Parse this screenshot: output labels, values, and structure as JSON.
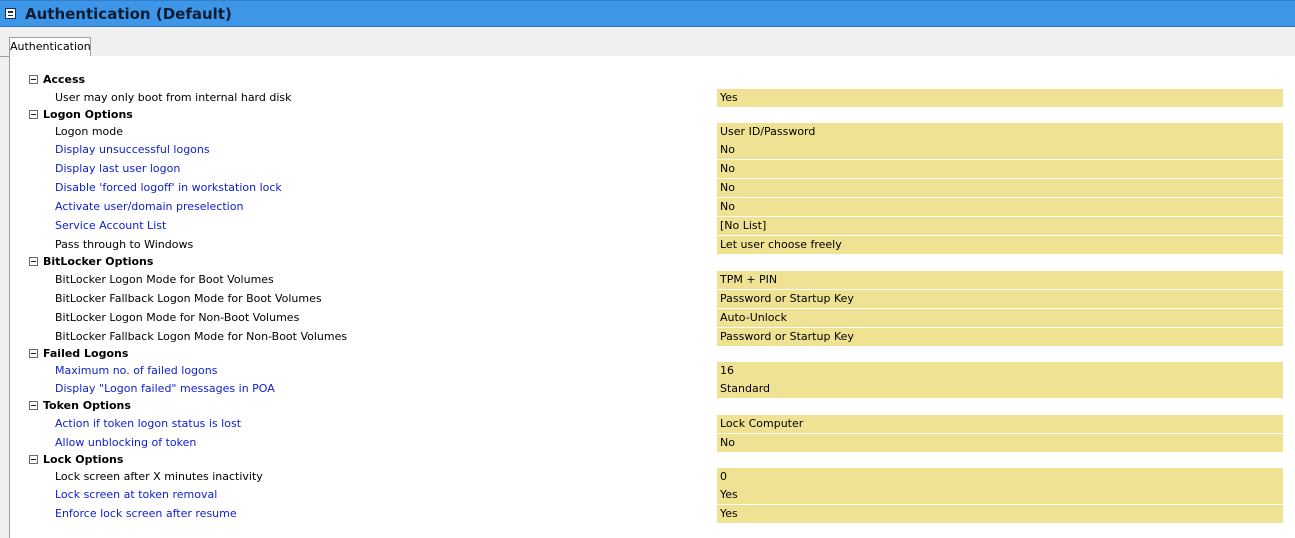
{
  "window": {
    "title": "Authentication (Default)"
  },
  "tabs": [
    {
      "label": "Authentication"
    }
  ],
  "sections": [
    {
      "title": "Access",
      "items": [
        {
          "label": "User may only boot from internal hard disk",
          "value": "Yes",
          "link": false
        }
      ]
    },
    {
      "title": "Logon Options",
      "items": [
        {
          "label": "Logon mode",
          "value": "User ID/Password",
          "link": false
        },
        {
          "label": "Display unsuccessful logons",
          "value": "No",
          "link": true
        },
        {
          "label": "Display last user logon",
          "value": "No",
          "link": true
        },
        {
          "label": "Disable 'forced logoff' in workstation lock",
          "value": "No",
          "link": true
        },
        {
          "label": "Activate user/domain preselection",
          "value": "No",
          "link": true
        },
        {
          "label": "Service Account List",
          "value": "[No List]",
          "link": true
        },
        {
          "label": "Pass through to Windows",
          "value": "Let user choose freely",
          "link": false
        }
      ]
    },
    {
      "title": "BitLocker Options",
      "items": [
        {
          "label": "BitLocker Logon Mode for Boot Volumes",
          "value": "TPM + PIN",
          "link": false
        },
        {
          "label": "BitLocker Fallback Logon Mode for Boot Volumes",
          "value": "Password or Startup Key",
          "link": false
        },
        {
          "label": "BitLocker Logon Mode for Non-Boot Volumes",
          "value": "Auto-Unlock",
          "link": false
        },
        {
          "label": "BitLocker Fallback Logon Mode for Non-Boot Volumes",
          "value": "Password or Startup Key",
          "link": false
        }
      ]
    },
    {
      "title": "Failed Logons",
      "items": [
        {
          "label": "Maximum no. of failed logons",
          "value": "16",
          "link": true
        },
        {
          "label": "Display \"Logon failed\" messages in POA",
          "value": "Standard",
          "link": true
        }
      ]
    },
    {
      "title": "Token Options",
      "items": [
        {
          "label": "Action if token logon status is lost",
          "value": "Lock Computer",
          "link": true
        },
        {
          "label": "Allow unblocking of token",
          "value": "No",
          "link": true
        }
      ]
    },
    {
      "title": "Lock Options",
      "items": [
        {
          "label": "Lock screen after X minutes inactivity",
          "value": "0",
          "link": false
        },
        {
          "label": "Lock screen at token removal",
          "value": "Yes",
          "link": true
        },
        {
          "label": "Enforce lock screen after resume",
          "value": "Yes",
          "link": true
        }
      ]
    }
  ]
}
